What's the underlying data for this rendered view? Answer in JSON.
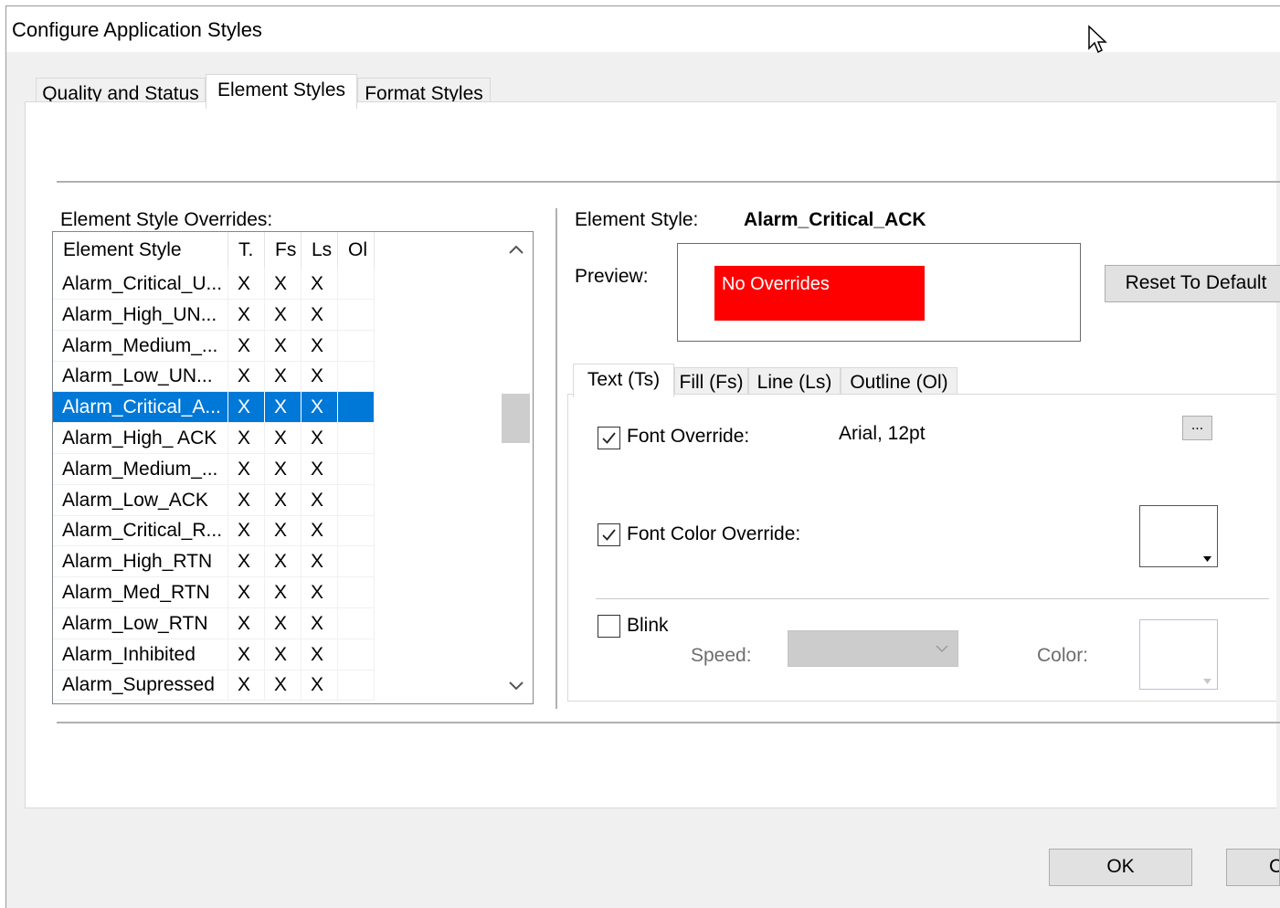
{
  "window": {
    "title": "Configure Application Styles"
  },
  "tabs": [
    {
      "label": "Quality and Status"
    },
    {
      "label": "Element Styles"
    },
    {
      "label": "Format Styles"
    }
  ],
  "overrides": {
    "label": "Element Style Overrides:",
    "columns": [
      "Element Style",
      "T.",
      "Fs",
      "Ls",
      "Ol"
    ],
    "rows": [
      {
        "name": "Alarm_Critical_U...",
        "t": "X",
        "fs": "X",
        "ls": "X",
        "ol": ""
      },
      {
        "name": "Alarm_High_UN...",
        "t": "X",
        "fs": "X",
        "ls": "X",
        "ol": ""
      },
      {
        "name": "Alarm_Medium_...",
        "t": "X",
        "fs": "X",
        "ls": "X",
        "ol": ""
      },
      {
        "name": "Alarm_Low_UN...",
        "t": "X",
        "fs": "X",
        "ls": "X",
        "ol": ""
      },
      {
        "name": "Alarm_Critical_A...",
        "t": "X",
        "fs": "X",
        "ls": "X",
        "ol": ""
      },
      {
        "name": "Alarm_High_ ACK",
        "t": "X",
        "fs": "X",
        "ls": "X",
        "ol": ""
      },
      {
        "name": "Alarm_Medium_...",
        "t": "X",
        "fs": "X",
        "ls": "X",
        "ol": ""
      },
      {
        "name": "Alarm_Low_ACK",
        "t": "X",
        "fs": "X",
        "ls": "X",
        "ol": ""
      },
      {
        "name": "Alarm_Critical_R...",
        "t": "X",
        "fs": "X",
        "ls": "X",
        "ol": ""
      },
      {
        "name": "Alarm_High_RTN",
        "t": "X",
        "fs": "X",
        "ls": "X",
        "ol": ""
      },
      {
        "name": "Alarm_Med_RTN",
        "t": "X",
        "fs": "X",
        "ls": "X",
        "ol": ""
      },
      {
        "name": "Alarm_Low_RTN",
        "t": "X",
        "fs": "X",
        "ls": "X",
        "ol": ""
      },
      {
        "name": "Alarm_Inhibited",
        "t": "X",
        "fs": "X",
        "ls": "X",
        "ol": ""
      },
      {
        "name": "Alarm_Supressed",
        "t": "X",
        "fs": "X",
        "ls": "X",
        "ol": ""
      }
    ],
    "selected_index": 4
  },
  "detail": {
    "element_style_label": "Element Style:",
    "element_style_value": "Alarm_Critical_ACK",
    "preview_label": "Preview:",
    "preview_text": "No Overrides",
    "preview_bg": "#ff0000",
    "preview_fg": "#ffffff",
    "reset_button": "Reset To Default"
  },
  "subtabs": [
    {
      "label": "Text (Ts)"
    },
    {
      "label": "Fill (Fs)"
    },
    {
      "label": "Line (Ls)"
    },
    {
      "label": "Outline (Ol)"
    }
  ],
  "text_tab": {
    "font_override_label": "Font Override:",
    "font_override_checked": true,
    "font_value": "Arial, 12pt",
    "browse_button": "...",
    "font_color_label": "Font Color Override:",
    "font_color_checked": true,
    "blink_label": "Blink",
    "blink_checked": false,
    "speed_label": "Speed:",
    "speed_value": "",
    "color_label": "Color:"
  },
  "footer": {
    "ok": "OK",
    "cancel": "C"
  },
  "colors": {
    "selection": "#0078d7",
    "dialog_bg": "#f0f0f0"
  }
}
